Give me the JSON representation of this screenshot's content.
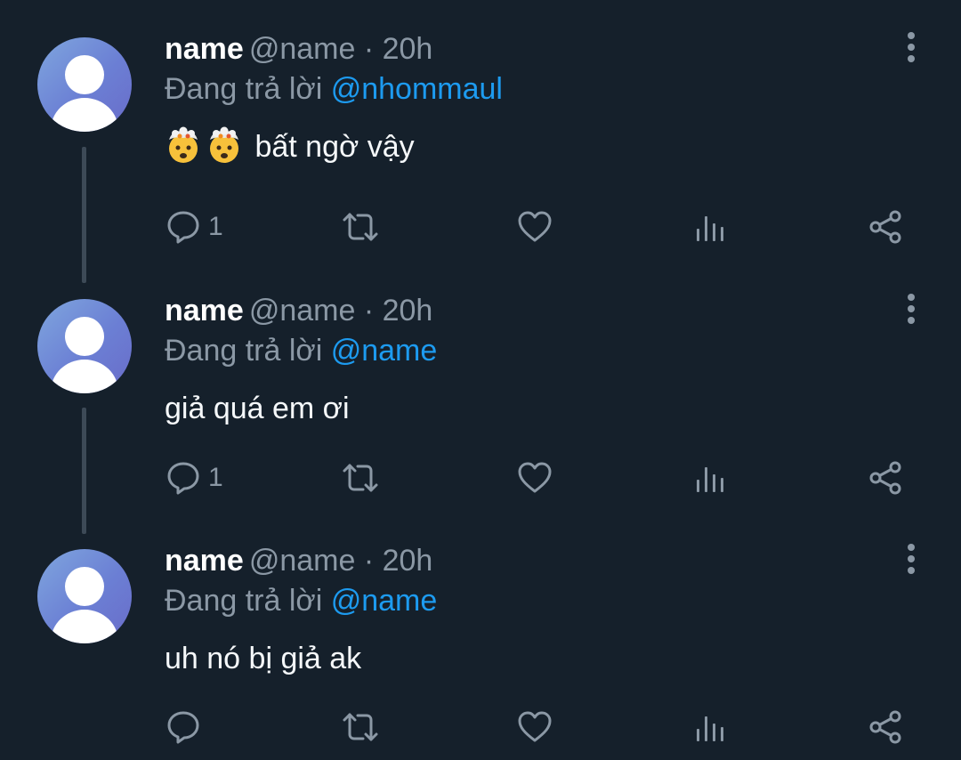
{
  "replying_to_prefix": "Đang trả lời",
  "colors": {
    "background": "#15202b",
    "secondary_text": "#8b98a5",
    "mention": "#1d9bf0",
    "thread_line": "#3d4a57",
    "avatar_gradient": [
      "#7fa6de",
      "#6a6cc9"
    ]
  },
  "tweets": [
    {
      "display_name": "name",
      "handle_time": "@name · 20h",
      "reply_to": "@nhommaul",
      "text": "bất ngờ vậy",
      "emojis": [
        "exploding-head-emoji",
        "exploding-head-emoji"
      ],
      "reply_count": "1"
    },
    {
      "display_name": "name",
      "handle_time": "@name · 20h",
      "reply_to": "@name",
      "text": "giả quá em ơi",
      "reply_count": "1"
    },
    {
      "display_name": "name",
      "handle_time": "@name · 20h",
      "reply_to": "@name",
      "text": "uh nó bị giả ak",
      "reply_count": ""
    }
  ],
  "icons": {
    "reply": "reply-icon",
    "retweet": "retweet-icon",
    "like": "like-icon",
    "analytics": "analytics-icon",
    "share": "share-icon",
    "more": "more-icon"
  }
}
